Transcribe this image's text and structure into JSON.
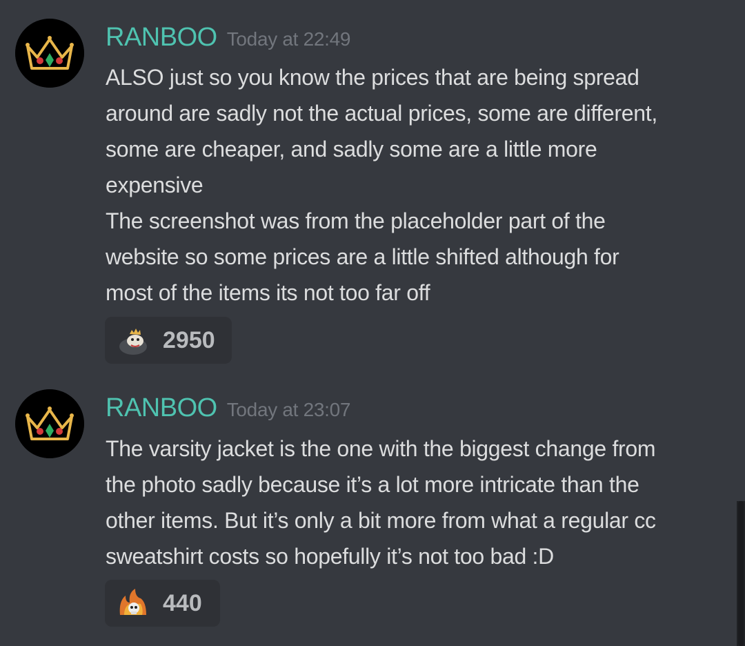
{
  "messages": [
    {
      "author": "RANBOO",
      "timestamp": "Today at 22:49",
      "lines": [
        "ALSO just so you know the prices that are being spread",
        "around are sadly not the actual prices, some are different,",
        "some are cheaper, and sadly some are a little more",
        "expensive",
        "The screenshot was from the placeholder part of the",
        "website so some prices are a little shifted although for",
        "most of the items its not too far off"
      ],
      "reaction": {
        "emoji": "crowned-frog-emoji",
        "count": "2950"
      }
    },
    {
      "author": "RANBOO",
      "timestamp": "Today at 23:07",
      "lines": [
        "The varsity jacket is the one with the biggest change from",
        "the photo sadly because it’s a lot more intricate than the",
        "other items. But it’s only a bit more from what a regular cc",
        "sweatshirt costs so hopefully it’s not too bad :D"
      ],
      "reaction": {
        "emoji": "fire-skull-emoji",
        "count": "440"
      }
    }
  ],
  "colors": {
    "background": "#36393f",
    "username": "#4fc3b0",
    "timestamp": "#72767d",
    "text": "#dcddde",
    "reaction_bg": "#2f3136"
  }
}
